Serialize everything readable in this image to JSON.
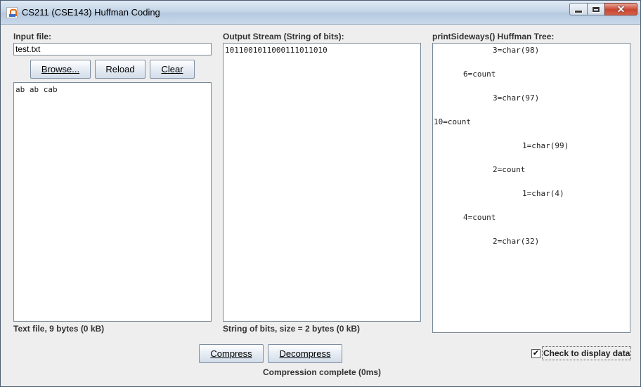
{
  "window": {
    "title": "CS211 (CSE143) Huffman Coding",
    "controls": {
      "close": "✕"
    }
  },
  "input": {
    "label": "Input file:",
    "file_value": "test.txt",
    "browse_label": "Browse...",
    "reload_label": "Reload",
    "clear_label": "Clear",
    "text_content": "ab ab cab",
    "status": "Text file, 9 bytes (0 kB)"
  },
  "output": {
    "label": "Output Stream (String of bits):",
    "bits": "1011001011000111011010",
    "status": "String of bits, size = 2 bytes  (0 kB)"
  },
  "tree": {
    "label": "printSideways() Huffman Tree:",
    "lines": [
      "3=char(98)",
      "6=count",
      "3=char(97)",
      "10=count",
      "1=char(99)",
      "2=count",
      "1=char(4)",
      "4=count",
      "2=char(32)"
    ]
  },
  "actions": {
    "compress_label": "Compress",
    "decompress_label": "Decompress",
    "status": "Compression complete (0ms)",
    "display_data_label": "Check to display data",
    "display_data_checked": "✔"
  }
}
